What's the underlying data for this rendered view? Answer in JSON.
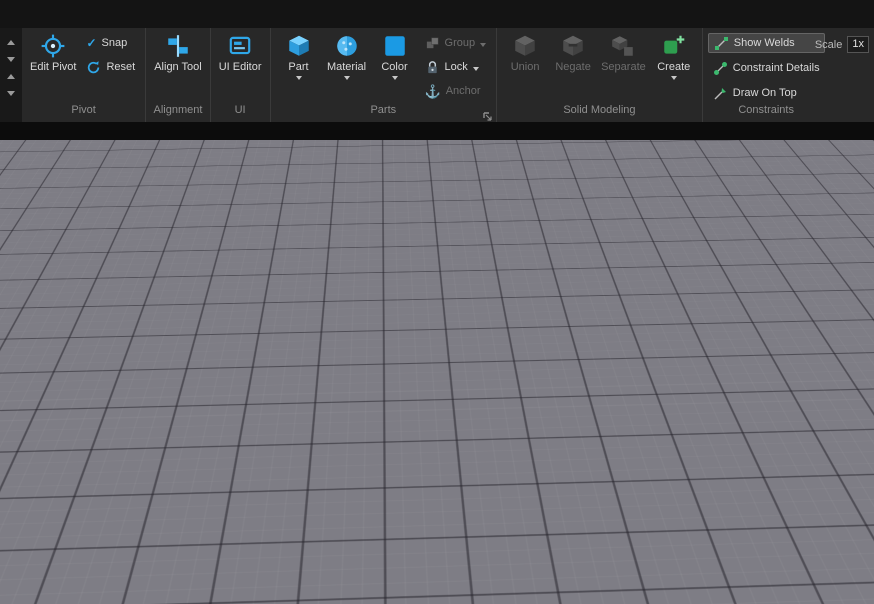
{
  "theme": {
    "accent_blue": "#2fa7e9",
    "accent_green": "#3cb96e",
    "ribbon_bg": "#282828",
    "viewport_bg": "#6f6e77"
  },
  "icons": {
    "check": "✓",
    "anchor": "⚓"
  },
  "ribbon": {
    "pivot": {
      "group_label": "Pivot",
      "edit_pivot": "Edit Pivot",
      "snap": "Snap",
      "reset": "Reset"
    },
    "alignment": {
      "group_label": "Alignment",
      "align_tool": "Align Tool"
    },
    "ui": {
      "group_label": "UI",
      "ui_editor": "UI Editor"
    },
    "parts": {
      "group_label": "Parts",
      "part": "Part",
      "material": "Material",
      "color": "Color",
      "group": "Group",
      "lock": "Lock",
      "anchor": "Anchor"
    },
    "solid_modeling": {
      "group_label": "Solid Modeling",
      "union": "Union",
      "negate": "Negate",
      "separate": "Separate",
      "create": "Create"
    },
    "constraints": {
      "group_label": "Constraints",
      "show_welds": "Show Welds",
      "constraint_details": "Constraint Details",
      "draw_on_top": "Draw On Top",
      "scale_label": "Scale",
      "scale_value": "1x"
    }
  },
  "scene": {
    "blue_top": "#47bdf1",
    "blue_front": "#2795cd",
    "blue_left": "#1b7fb4",
    "red_front": "#e2150d",
    "red_left": "#a80f0a"
  }
}
